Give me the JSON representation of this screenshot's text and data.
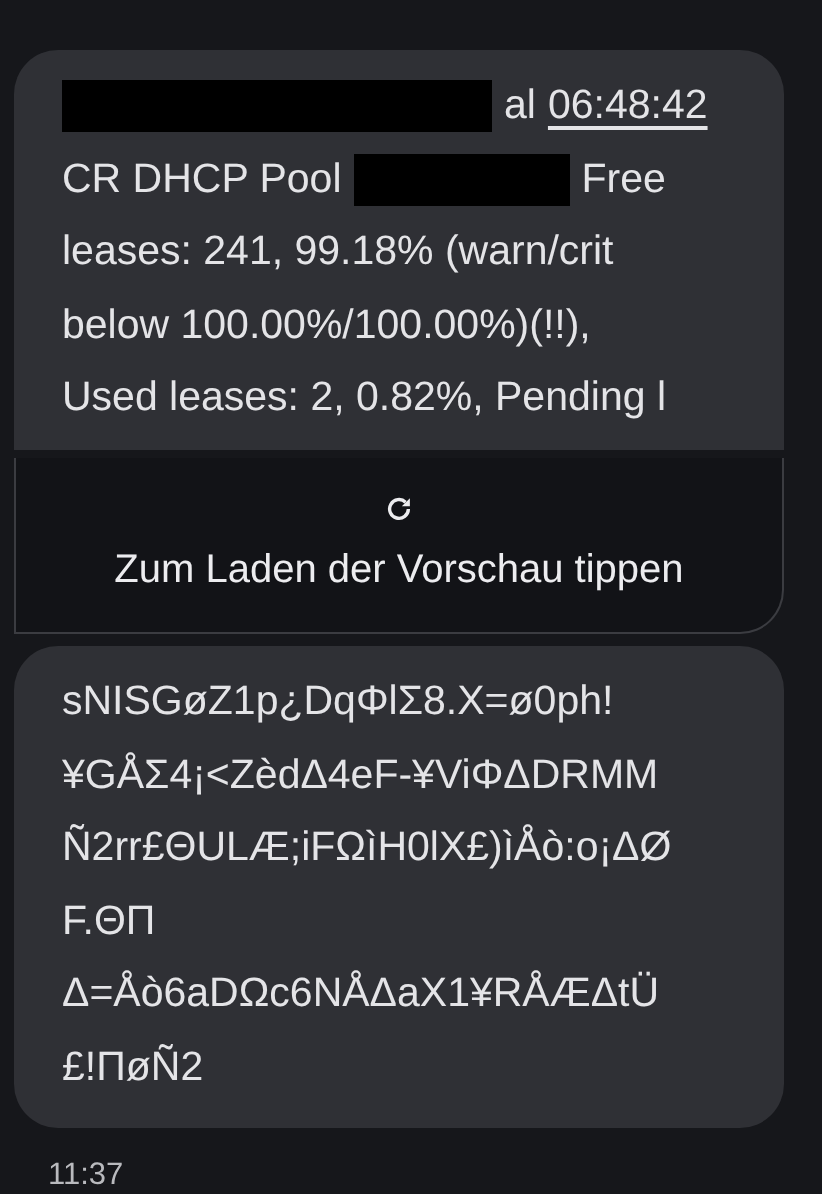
{
  "messages": [
    {
      "kind": "link_preview",
      "lines": [
        [
          {
            "kind": "redacted"
          },
          {
            "kind": "text",
            "text": "al"
          },
          {
            "kind": "link",
            "text": "06:48:42"
          }
        ],
        [
          {
            "kind": "text",
            "text": "CR DHCP Pool"
          },
          {
            "kind": "redacted"
          },
          {
            "kind": "text",
            "text": "Free"
          }
        ],
        [
          {
            "kind": "text",
            "text": "leases: 241, 99.18% (warn/crit"
          }
        ],
        [
          {
            "kind": "text",
            "text": "below 100.00%/100.00%)(!!),"
          }
        ],
        [
          {
            "kind": "text",
            "text": "Used leases: 2, 0.82%, Pending l"
          }
        ]
      ],
      "preview": {
        "label": "Zum Laden der Vorschau tippen"
      }
    },
    {
      "kind": "plain",
      "lines": [
        [
          {
            "kind": "text",
            "text": "sNISGøZ1p¿DqΦlΣ8.X=ø0ph!"
          }
        ],
        [
          {
            "kind": "text",
            "text": "¥GÅΣ4¡<ZèdΔ4eF-¥ViΦΔDRMM"
          }
        ],
        [
          {
            "kind": "text",
            "text": "Ñ2rr£ΘULÆ;iFΩìH0lX£)ìÅò:o¡ΔØ"
          }
        ],
        [
          {
            "kind": "text",
            "text": "F.ΘΠ"
          }
        ],
        [
          {
            "kind": "text",
            "text": "Δ=Åò6aDΩc6NÅΔaX1¥RÅÆΔtÜ"
          }
        ],
        [
          {
            "kind": "text",
            "text": "£!ΠøÑ2"
          }
        ]
      ]
    }
  ],
  "timestamp": "11:37"
}
